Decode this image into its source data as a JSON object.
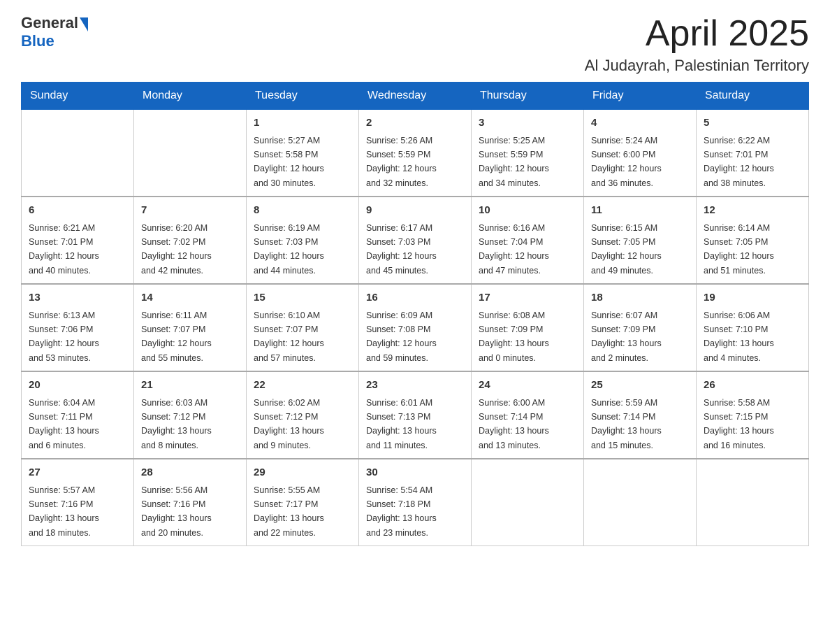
{
  "header": {
    "logo_general": "General",
    "logo_blue": "Blue",
    "month_title": "April 2025",
    "location": "Al Judayrah, Palestinian Territory"
  },
  "weekdays": [
    "Sunday",
    "Monday",
    "Tuesday",
    "Wednesday",
    "Thursday",
    "Friday",
    "Saturday"
  ],
  "weeks": [
    [
      {
        "day": "",
        "info": ""
      },
      {
        "day": "",
        "info": ""
      },
      {
        "day": "1",
        "info": "Sunrise: 5:27 AM\nSunset: 5:58 PM\nDaylight: 12 hours\nand 30 minutes."
      },
      {
        "day": "2",
        "info": "Sunrise: 5:26 AM\nSunset: 5:59 PM\nDaylight: 12 hours\nand 32 minutes."
      },
      {
        "day": "3",
        "info": "Sunrise: 5:25 AM\nSunset: 5:59 PM\nDaylight: 12 hours\nand 34 minutes."
      },
      {
        "day": "4",
        "info": "Sunrise: 5:24 AM\nSunset: 6:00 PM\nDaylight: 12 hours\nand 36 minutes."
      },
      {
        "day": "5",
        "info": "Sunrise: 6:22 AM\nSunset: 7:01 PM\nDaylight: 12 hours\nand 38 minutes."
      }
    ],
    [
      {
        "day": "6",
        "info": "Sunrise: 6:21 AM\nSunset: 7:01 PM\nDaylight: 12 hours\nand 40 minutes."
      },
      {
        "day": "7",
        "info": "Sunrise: 6:20 AM\nSunset: 7:02 PM\nDaylight: 12 hours\nand 42 minutes."
      },
      {
        "day": "8",
        "info": "Sunrise: 6:19 AM\nSunset: 7:03 PM\nDaylight: 12 hours\nand 44 minutes."
      },
      {
        "day": "9",
        "info": "Sunrise: 6:17 AM\nSunset: 7:03 PM\nDaylight: 12 hours\nand 45 minutes."
      },
      {
        "day": "10",
        "info": "Sunrise: 6:16 AM\nSunset: 7:04 PM\nDaylight: 12 hours\nand 47 minutes."
      },
      {
        "day": "11",
        "info": "Sunrise: 6:15 AM\nSunset: 7:05 PM\nDaylight: 12 hours\nand 49 minutes."
      },
      {
        "day": "12",
        "info": "Sunrise: 6:14 AM\nSunset: 7:05 PM\nDaylight: 12 hours\nand 51 minutes."
      }
    ],
    [
      {
        "day": "13",
        "info": "Sunrise: 6:13 AM\nSunset: 7:06 PM\nDaylight: 12 hours\nand 53 minutes."
      },
      {
        "day": "14",
        "info": "Sunrise: 6:11 AM\nSunset: 7:07 PM\nDaylight: 12 hours\nand 55 minutes."
      },
      {
        "day": "15",
        "info": "Sunrise: 6:10 AM\nSunset: 7:07 PM\nDaylight: 12 hours\nand 57 minutes."
      },
      {
        "day": "16",
        "info": "Sunrise: 6:09 AM\nSunset: 7:08 PM\nDaylight: 12 hours\nand 59 minutes."
      },
      {
        "day": "17",
        "info": "Sunrise: 6:08 AM\nSunset: 7:09 PM\nDaylight: 13 hours\nand 0 minutes."
      },
      {
        "day": "18",
        "info": "Sunrise: 6:07 AM\nSunset: 7:09 PM\nDaylight: 13 hours\nand 2 minutes."
      },
      {
        "day": "19",
        "info": "Sunrise: 6:06 AM\nSunset: 7:10 PM\nDaylight: 13 hours\nand 4 minutes."
      }
    ],
    [
      {
        "day": "20",
        "info": "Sunrise: 6:04 AM\nSunset: 7:11 PM\nDaylight: 13 hours\nand 6 minutes."
      },
      {
        "day": "21",
        "info": "Sunrise: 6:03 AM\nSunset: 7:12 PM\nDaylight: 13 hours\nand 8 minutes."
      },
      {
        "day": "22",
        "info": "Sunrise: 6:02 AM\nSunset: 7:12 PM\nDaylight: 13 hours\nand 9 minutes."
      },
      {
        "day": "23",
        "info": "Sunrise: 6:01 AM\nSunset: 7:13 PM\nDaylight: 13 hours\nand 11 minutes."
      },
      {
        "day": "24",
        "info": "Sunrise: 6:00 AM\nSunset: 7:14 PM\nDaylight: 13 hours\nand 13 minutes."
      },
      {
        "day": "25",
        "info": "Sunrise: 5:59 AM\nSunset: 7:14 PM\nDaylight: 13 hours\nand 15 minutes."
      },
      {
        "day": "26",
        "info": "Sunrise: 5:58 AM\nSunset: 7:15 PM\nDaylight: 13 hours\nand 16 minutes."
      }
    ],
    [
      {
        "day": "27",
        "info": "Sunrise: 5:57 AM\nSunset: 7:16 PM\nDaylight: 13 hours\nand 18 minutes."
      },
      {
        "day": "28",
        "info": "Sunrise: 5:56 AM\nSunset: 7:16 PM\nDaylight: 13 hours\nand 20 minutes."
      },
      {
        "day": "29",
        "info": "Sunrise: 5:55 AM\nSunset: 7:17 PM\nDaylight: 13 hours\nand 22 minutes."
      },
      {
        "day": "30",
        "info": "Sunrise: 5:54 AM\nSunset: 7:18 PM\nDaylight: 13 hours\nand 23 minutes."
      },
      {
        "day": "",
        "info": ""
      },
      {
        "day": "",
        "info": ""
      },
      {
        "day": "",
        "info": ""
      }
    ]
  ]
}
